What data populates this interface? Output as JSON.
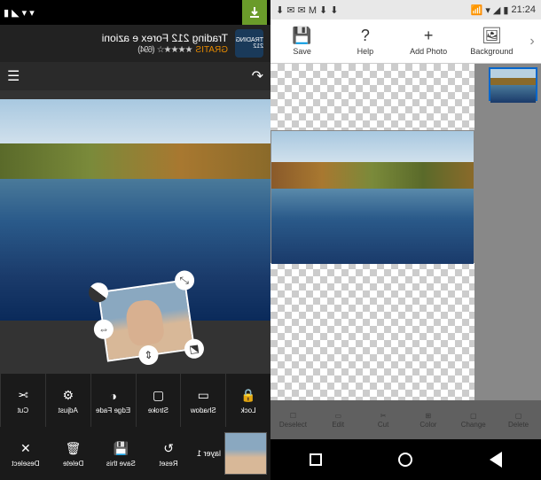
{
  "left": {
    "ad": {
      "logo_text": "TRADING 212",
      "title": "Trading 212 Forex e azioni",
      "badge": "GRATIS",
      "rating_count": "(694)",
      "stars": "★★★★☆"
    },
    "toolbar": [
      {
        "icon": "🔒",
        "label": "Lock",
        "name": "lock-button"
      },
      {
        "icon": "▭",
        "label": "Shadow",
        "name": "shadow-button"
      },
      {
        "icon": "▢",
        "label": "Stroke",
        "name": "stroke-button"
      },
      {
        "icon": "◐",
        "label": "Edge Fade",
        "name": "edge-fade-button"
      },
      {
        "icon": "⚙",
        "label": "Adjust",
        "name": "adjust-button"
      },
      {
        "icon": "✂",
        "label": "Cut",
        "name": "cut-button"
      }
    ],
    "layer_label": "layer 1",
    "bottom": [
      {
        "icon": "↻",
        "label": "Reset",
        "name": "reset-button"
      },
      {
        "icon": "💾",
        "label": "Save this",
        "name": "save-this-button"
      },
      {
        "icon": "🗑",
        "label": "Delete",
        "name": "delete-button"
      },
      {
        "icon": "✕",
        "label": "Deselect",
        "name": "deselect-button"
      }
    ]
  },
  "right": {
    "time": "21:24",
    "toolbar": [
      {
        "icon": "💾",
        "label": "Save",
        "name": "save-button"
      },
      {
        "icon": "?",
        "label": "Help",
        "name": "help-button"
      },
      {
        "icon": "+",
        "label": "Add Photo",
        "name": "add-photo-button"
      },
      {
        "icon": "🖼",
        "label": "Background",
        "name": "background-button"
      }
    ],
    "midbar": [
      {
        "label": "Deselect",
        "name": "deselect-button"
      },
      {
        "label": "Edit",
        "name": "edit-button"
      },
      {
        "label": "Cut",
        "name": "cut-button"
      },
      {
        "label": "Color",
        "name": "color-button"
      },
      {
        "label": "Change",
        "name": "change-button"
      },
      {
        "label": "Delete",
        "name": "delete-button"
      }
    ]
  }
}
